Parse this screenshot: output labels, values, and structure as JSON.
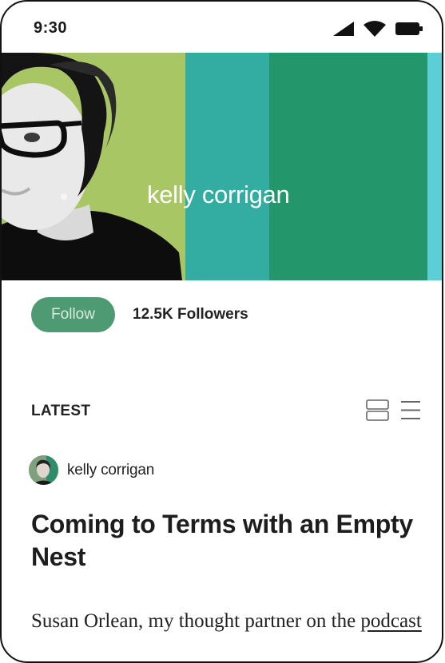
{
  "status_bar": {
    "time": "9:30",
    "icons": [
      "cellular-signal-icon",
      "wifi-icon",
      "battery-icon"
    ]
  },
  "banner": {
    "title": "kelly corrigan",
    "stripe_colors": [
      "#a9c665",
      "#33ada1",
      "#23966c",
      "#5ccfd6"
    ]
  },
  "profile": {
    "follow_label": "Follow",
    "followers_count": "12.5K",
    "followers_label": "Followers",
    "accent_color": "#4e9a72"
  },
  "feed": {
    "section_label": "LATEST",
    "view_toggles": [
      "card-view-icon",
      "list-view-icon"
    ],
    "posts": [
      {
        "author": "kelly corrigan",
        "title": "Coming to Terms with an Empty Nest",
        "excerpt_text": "Susan Orlean, my thought partner on the ",
        "excerpt_link": "podcast"
      }
    ]
  }
}
